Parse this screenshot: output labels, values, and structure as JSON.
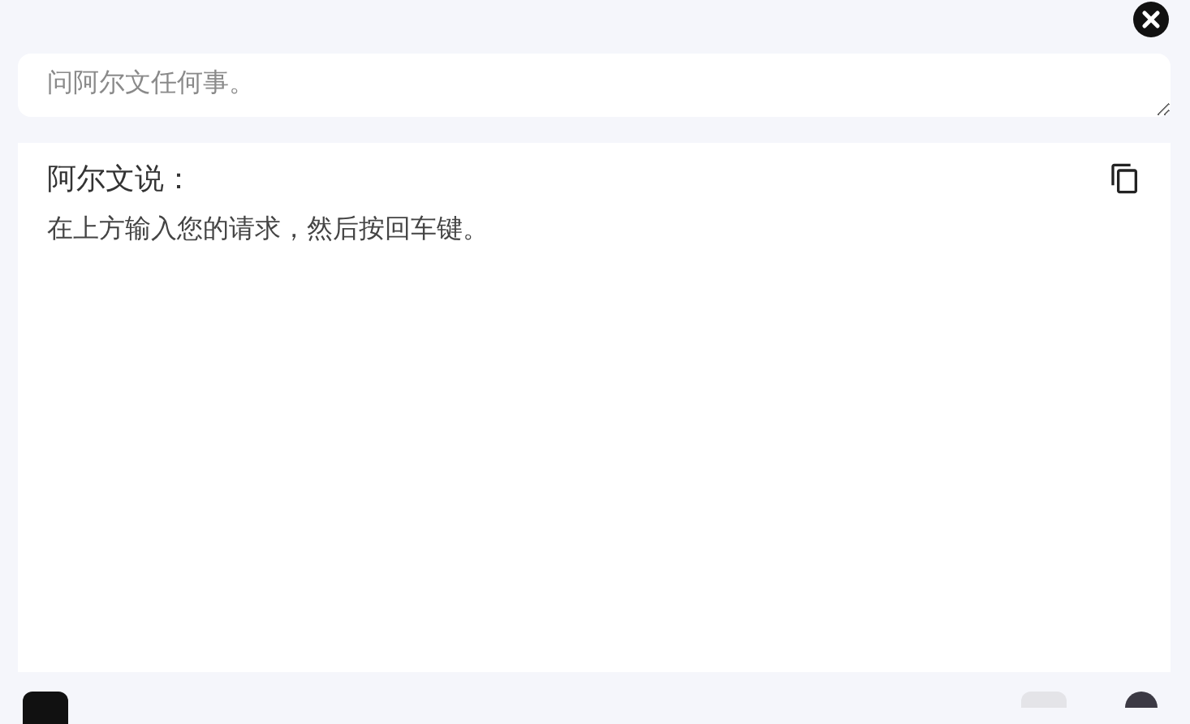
{
  "prompt": {
    "placeholder": "问阿尔文任何事。"
  },
  "response": {
    "title": "阿尔文说：",
    "text": "在上方输入您的请求，然后按回车键。"
  }
}
